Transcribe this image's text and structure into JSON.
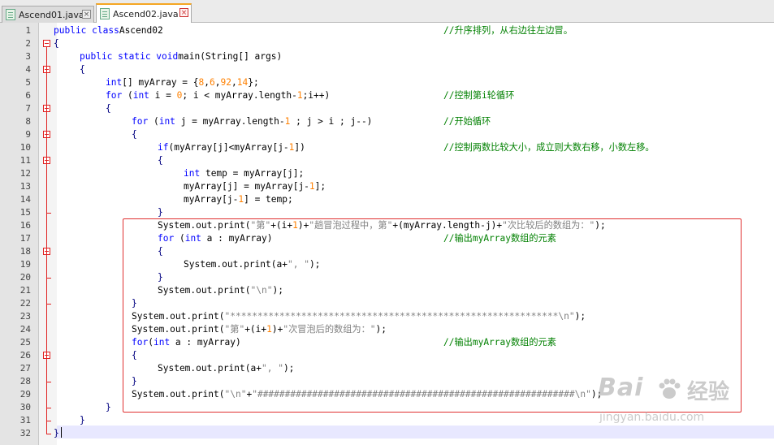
{
  "tabs": [
    {
      "label": "Ascend01.java",
      "active": false
    },
    {
      "label": "Ascend02.java",
      "active": true
    }
  ],
  "colors": {
    "keyword": "#0000ff",
    "number": "#ff8000",
    "string": "#808080",
    "comment": "#008000",
    "highlight_box": "#e03030",
    "fold_marker": "#e02020"
  },
  "lines": [
    {
      "n": "1",
      "indent": 0,
      "tokens": [
        [
          "kw",
          "public class"
        ],
        [
          "",
          "Ascend02"
        ]
      ],
      "comment": "//升序排列，从右边往左边冒。"
    },
    {
      "n": "2",
      "indent": 0,
      "tokens": [
        [
          "op",
          "{"
        ]
      ],
      "comment": ""
    },
    {
      "n": "3",
      "indent": 1,
      "tokens": [
        [
          "kw",
          "public static void"
        ],
        [
          "",
          "main(String[] args)"
        ]
      ],
      "comment": ""
    },
    {
      "n": "4",
      "indent": 1,
      "tokens": [
        [
          "op",
          "{"
        ]
      ],
      "comment": ""
    },
    {
      "n": "5",
      "indent": 2,
      "tokens": [
        [
          "kw",
          "int"
        ],
        [
          "",
          "[] myArray = {"
        ],
        [
          "num",
          "8"
        ],
        [
          "",
          ","
        ],
        [
          "num",
          "6"
        ],
        [
          "",
          ","
        ],
        [
          "num",
          "92"
        ],
        [
          "",
          ","
        ],
        [
          "num",
          "14"
        ],
        [
          "",
          "};"
        ]
      ],
      "comment": ""
    },
    {
      "n": "6",
      "indent": 2,
      "tokens": [
        [
          "kw",
          "for"
        ],
        [
          "",
          " ("
        ],
        [
          "kw",
          "int"
        ],
        [
          "",
          " i = "
        ],
        [
          "num",
          "0"
        ],
        [
          "",
          "; i < myArray.length-"
        ],
        [
          "num",
          "1"
        ],
        [
          "",
          ";i++)"
        ]
      ],
      "comment": "//控制第i轮循环"
    },
    {
      "n": "7",
      "indent": 2,
      "tokens": [
        [
          "op",
          "{"
        ]
      ],
      "comment": ""
    },
    {
      "n": "8",
      "indent": 3,
      "tokens": [
        [
          "kw",
          "for"
        ],
        [
          "",
          " ("
        ],
        [
          "kw",
          "int"
        ],
        [
          "",
          " j = myArray.length-"
        ],
        [
          "num",
          "1"
        ],
        [
          "",
          " ; j > i ; j--)"
        ]
      ],
      "comment": "//开始循环"
    },
    {
      "n": "9",
      "indent": 3,
      "tokens": [
        [
          "op",
          "{"
        ]
      ],
      "comment": ""
    },
    {
      "n": "10",
      "indent": 4,
      "tokens": [
        [
          "kw",
          "if"
        ],
        [
          "",
          "(myArray[j]<myArray[j-"
        ],
        [
          "num",
          "1"
        ],
        [
          "",
          "])"
        ]
      ],
      "comment": "//控制两数比较大小，成立则大数右移，小数左移。"
    },
    {
      "n": "11",
      "indent": 4,
      "tokens": [
        [
          "op",
          "{"
        ]
      ],
      "comment": ""
    },
    {
      "n": "12",
      "indent": 5,
      "tokens": [
        [
          "kw",
          "int"
        ],
        [
          "",
          " temp = myArray[j];"
        ]
      ],
      "comment": ""
    },
    {
      "n": "13",
      "indent": 5,
      "tokens": [
        [
          "",
          "myArray[j] = myArray[j-"
        ],
        [
          "num",
          "1"
        ],
        [
          "",
          "];"
        ]
      ],
      "comment": ""
    },
    {
      "n": "14",
      "indent": 5,
      "tokens": [
        [
          "",
          "myArray[j-"
        ],
        [
          "num",
          "1"
        ],
        [
          "",
          "] = temp;"
        ]
      ],
      "comment": ""
    },
    {
      "n": "15",
      "indent": 4,
      "tokens": [
        [
          "op",
          "}"
        ]
      ],
      "comment": ""
    },
    {
      "n": "16",
      "indent": 4,
      "tokens": [
        [
          "",
          "System.out.print("
        ],
        [
          "str",
          "\"第\""
        ],
        [
          "",
          "+(i+"
        ],
        [
          "num",
          "1"
        ],
        [
          "",
          ")+"
        ],
        [
          "str",
          "\"趟冒泡过程中，第\""
        ],
        [
          "",
          "+(myArray.length-j)+"
        ],
        [
          "str",
          "\"次比较后的数组为：\""
        ],
        [
          "",
          ");"
        ]
      ],
      "comment": ""
    },
    {
      "n": "17",
      "indent": 4,
      "tokens": [
        [
          "kw",
          "for"
        ],
        [
          "",
          " ("
        ],
        [
          "kw",
          "int"
        ],
        [
          "",
          " a : myArray)"
        ]
      ],
      "comment": "//输出myArray数组的元素"
    },
    {
      "n": "18",
      "indent": 4,
      "tokens": [
        [
          "op",
          "{"
        ]
      ],
      "comment": ""
    },
    {
      "n": "19",
      "indent": 5,
      "tokens": [
        [
          "",
          "System.out.print(a+"
        ],
        [
          "str",
          "\", \""
        ],
        [
          "",
          ");"
        ]
      ],
      "comment": ""
    },
    {
      "n": "20",
      "indent": 4,
      "tokens": [
        [
          "op",
          "}"
        ]
      ],
      "comment": ""
    },
    {
      "n": "21",
      "indent": 4,
      "tokens": [
        [
          "",
          "System.out.print("
        ],
        [
          "str",
          "\"\\n\""
        ],
        [
          "",
          ");"
        ]
      ],
      "comment": ""
    },
    {
      "n": "22",
      "indent": 3,
      "tokens": [
        [
          "op",
          "}"
        ]
      ],
      "comment": ""
    },
    {
      "n": "23",
      "indent": 3,
      "tokens": [
        [
          "",
          "System.out.print("
        ],
        [
          "str",
          "\"************************************************************\\n\""
        ],
        [
          "",
          ");"
        ]
      ],
      "comment": ""
    },
    {
      "n": "24",
      "indent": 3,
      "tokens": [
        [
          "",
          "System.out.print("
        ],
        [
          "str",
          "\"第\""
        ],
        [
          "",
          "+(i+"
        ],
        [
          "num",
          "1"
        ],
        [
          "",
          ")+"
        ],
        [
          "str",
          "\"次冒泡后的数组为：\""
        ],
        [
          "",
          ");"
        ]
      ],
      "comment": ""
    },
    {
      "n": "25",
      "indent": 3,
      "tokens": [
        [
          "kw",
          "for"
        ],
        [
          "",
          "("
        ],
        [
          "kw",
          "int"
        ],
        [
          "",
          " a : myArray)"
        ]
      ],
      "comment": "//输出myArray数组的元素"
    },
    {
      "n": "26",
      "indent": 3,
      "tokens": [
        [
          "op",
          "{"
        ]
      ],
      "comment": ""
    },
    {
      "n": "27",
      "indent": 4,
      "tokens": [
        [
          "",
          "System.out.print(a+"
        ],
        [
          "str",
          "\", \""
        ],
        [
          "",
          ");"
        ]
      ],
      "comment": ""
    },
    {
      "n": "28",
      "indent": 3,
      "tokens": [
        [
          "op",
          "}"
        ]
      ],
      "comment": ""
    },
    {
      "n": "29",
      "indent": 3,
      "tokens": [
        [
          "",
          "System.out.print("
        ],
        [
          "str",
          "\"\\n\""
        ],
        [
          "",
          "+"
        ],
        [
          "str",
          "\"##########################################################\\n\""
        ],
        [
          "",
          ");"
        ]
      ],
      "comment": ""
    },
    {
      "n": "30",
      "indent": 2,
      "tokens": [
        [
          "op",
          "}"
        ]
      ],
      "comment": ""
    },
    {
      "n": "31",
      "indent": 1,
      "tokens": [
        [
          "op",
          "}"
        ]
      ],
      "comment": ""
    },
    {
      "n": "32",
      "indent": 0,
      "tokens": [
        [
          "op",
          "}"
        ]
      ],
      "comment": ""
    }
  ],
  "fold_open_lines": [
    "2",
    "4",
    "7",
    "9",
    "11",
    "18",
    "26"
  ],
  "watermark": {
    "brand": "Bai",
    "brand2": "经验",
    "url": "jingyan.baidu.com"
  }
}
